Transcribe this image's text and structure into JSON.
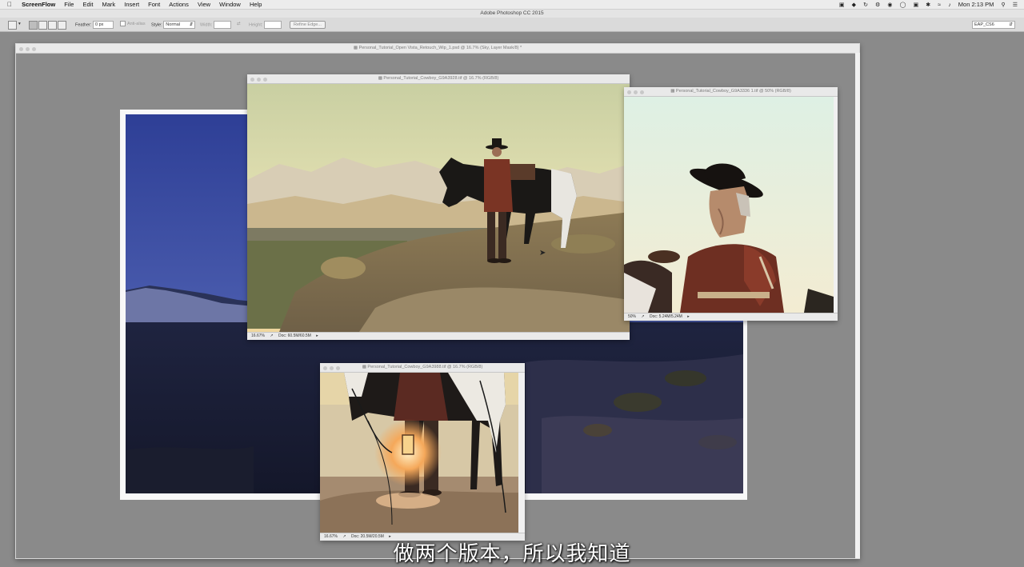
{
  "menubar": {
    "app_name": "ScreenFlow",
    "items": [
      "File",
      "Edit",
      "Mark",
      "Insert",
      "Font",
      "Actions",
      "View",
      "Window",
      "Help"
    ],
    "clock": "Mon 2:13 PM"
  },
  "photoshop": {
    "app_title": "Adobe Photoshop CC 2015",
    "options": {
      "feather_label": "Feather:",
      "feather_value": "0 px",
      "anti_alias_label": "Anti-alias",
      "style_label": "Style:",
      "style_value": "Normal",
      "width_label": "Width:",
      "height_label": "Height:",
      "refine_edge": "Refine Edge...",
      "workspace": "EAP_CS6"
    }
  },
  "windows": {
    "main": {
      "title": "Personal_Tutorial_Open Vista_Retouch_Wip_1.psd @ 16.7% (Sky, Layer Mask/8) *"
    },
    "cowboy_wide": {
      "title": "Personal_Tutorial_Cowboy_G9A3928.tif @ 16.7% (RGB/8)",
      "zoom": "16.67%",
      "doc": "Doc: 60.5M/60.5M"
    },
    "cowboy_close": {
      "title": "Personal_Tutorial_Cowboy_G9A3336 1.tif @ 50% (RGB/8)",
      "zoom": "50%",
      "doc": "Doc: 5.24M/5.24M"
    },
    "cowboy_lantern": {
      "title": "Personal_Tutorial_Cowboy_G9A3988.tif @ 16.7% (RGB/8)",
      "zoom": "16.67%",
      "doc": "Doc: 20.5M/20.5M"
    }
  },
  "subtitle": "做两个版本，所以我知道"
}
